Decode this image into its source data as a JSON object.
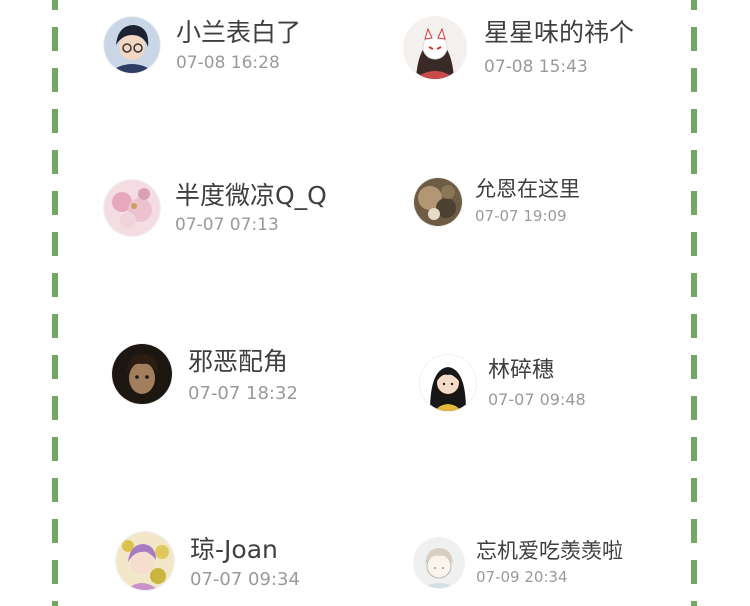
{
  "colors": {
    "dash": "#72a864",
    "name_text": "#3f3f3f",
    "time_text": "#9a9a9a"
  },
  "entries": [
    {
      "name": "小兰表白了",
      "time": "07-08 16:28",
      "avatar": "anime-boy-avatar"
    },
    {
      "name": "星星味的祎个",
      "time": "07-08 15:43",
      "avatar": "fox-mask-girl-avatar"
    },
    {
      "name": "半度微凉Q_Q",
      "time": "07-07 07:13",
      "avatar": "pink-flowers-avatar"
    },
    {
      "name": "允恩在这里",
      "time": "07-07 19:09",
      "avatar": "blurred-flower-photo-avatar"
    },
    {
      "name": "邪恶配角",
      "time": "07-07 18:32",
      "avatar": "dark-portrait-avatar"
    },
    {
      "name": "林碎穗",
      "time": "07-07 09:48",
      "avatar": "cartoon-girl-avatar"
    },
    {
      "name": "琼-Joan",
      "time": "07-07 09:34",
      "avatar": "anime-girl-flowers-avatar"
    },
    {
      "name": "忘机爱吃羡羡啦",
      "time": "07-09 20:34",
      "avatar": "sketch-boy-avatar"
    }
  ]
}
